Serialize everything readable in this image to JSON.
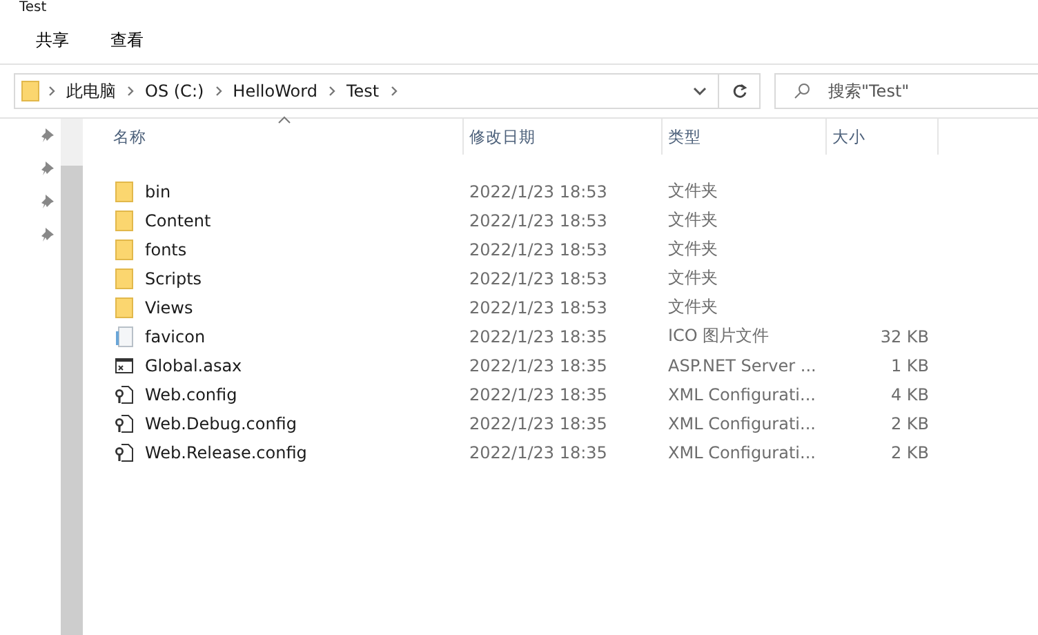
{
  "window": {
    "title": "Test"
  },
  "ribbon_tabs": [
    "共享",
    "查看"
  ],
  "address_bar": {
    "path": [
      "此电脑",
      "OS (C:)",
      "HelloWord",
      "Test"
    ]
  },
  "search": {
    "placeholder": "搜索\"Test\""
  },
  "table": {
    "columns": [
      "名称",
      "修改日期",
      "类型",
      "大小"
    ],
    "rows": [
      {
        "kind": "folder",
        "name": "bin",
        "date": "2022/1/23 18:53",
        "type": "文件夹",
        "size": ""
      },
      {
        "kind": "folder",
        "name": "Content",
        "date": "2022/1/23 18:53",
        "type": "文件夹",
        "size": ""
      },
      {
        "kind": "folder",
        "name": "fonts",
        "date": "2022/1/23 18:53",
        "type": "文件夹",
        "size": ""
      },
      {
        "kind": "folder",
        "name": "Scripts",
        "date": "2022/1/23 18:53",
        "type": "文件夹",
        "size": ""
      },
      {
        "kind": "folder",
        "name": "Views",
        "date": "2022/1/23 18:53",
        "type": "文件夹",
        "size": ""
      },
      {
        "kind": "image",
        "name": "favicon",
        "date": "2022/1/23 18:35",
        "type": "ICO 图片文件",
        "size": "32 KB"
      },
      {
        "kind": "asax",
        "name": "Global.asax",
        "date": "2022/1/23 18:35",
        "type": "ASP.NET Server ...",
        "size": "1 KB"
      },
      {
        "kind": "config",
        "name": "Web.config",
        "date": "2022/1/23 18:35",
        "type": "XML Configurati...",
        "size": "4 KB"
      },
      {
        "kind": "config",
        "name": "Web.Debug.config",
        "date": "2022/1/23 18:35",
        "type": "XML Configurati...",
        "size": "2 KB"
      },
      {
        "kind": "config",
        "name": "Web.Release.config",
        "date": "2022/1/23 18:35",
        "type": "XML Configurati...",
        "size": "2 KB"
      }
    ]
  }
}
